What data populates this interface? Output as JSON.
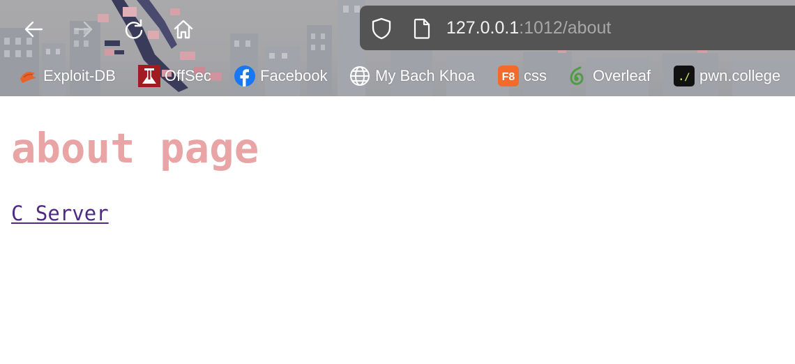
{
  "browser": {
    "url_host": "127.0.0.1",
    "url_rest": ":1012/about",
    "nav": {
      "back_icon": "arrow-left-icon",
      "forward_icon": "arrow-right-icon",
      "reload_icon": "reload-icon",
      "home_icon": "home-icon"
    },
    "bookmarks": [
      {
        "label": "Exploit-DB",
        "icon": "exploit-db-icon"
      },
      {
        "label": "OffSec",
        "icon": "offsec-icon"
      },
      {
        "label": "Facebook",
        "icon": "facebook-icon"
      },
      {
        "label": "My Bach Khoa",
        "icon": "globe-icon"
      },
      {
        "label": "css",
        "icon": "f8-icon",
        "icon_text": "F8"
      },
      {
        "label": "Overleaf",
        "icon": "overleaf-icon"
      },
      {
        "label": "pwn.college",
        "icon": "pwn-college-icon",
        "icon_text": "./"
      }
    ]
  },
  "page": {
    "heading": "about page",
    "link_label": "C Server"
  },
  "colors": {
    "heading": "#e9a5a5",
    "link": "#4e2a84",
    "urlbar": "#545455",
    "facebook": "#1877f2",
    "f8": "#f26b2a",
    "offsec": "#a21a22",
    "overleaf": "#4f9c45"
  }
}
